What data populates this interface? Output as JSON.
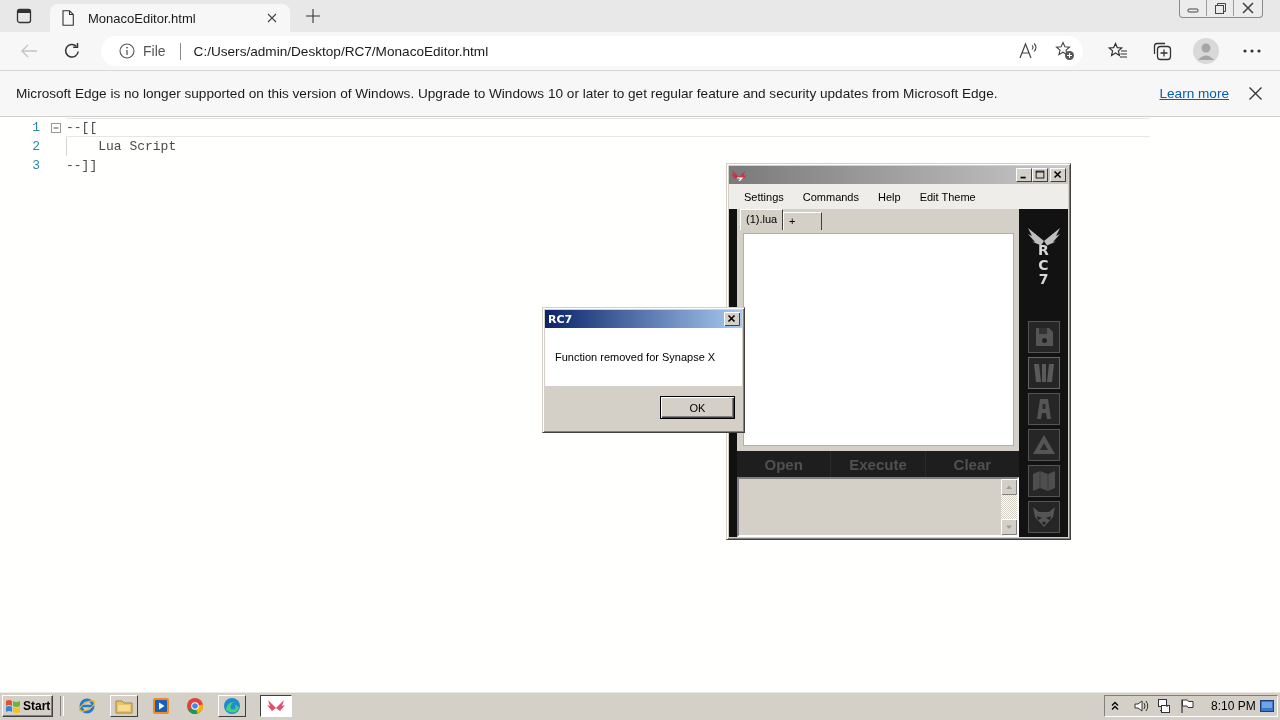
{
  "browser": {
    "tabs": [
      {
        "title": "MonacoEditor.html",
        "selected": true
      }
    ],
    "nav": {
      "back_disabled": true
    },
    "address_bar": {
      "scheme": "File",
      "url": "C:/Users/admin/Desktop/RC7/MonacoEditor.html"
    },
    "info_bar": {
      "message": "Microsoft Edge is no longer supported on this version of Windows. Upgrade to Windows 10 or later to get regular feature and security updates from Microsoft Edge.",
      "link": "Learn more"
    }
  },
  "editor": {
    "lines": [
      {
        "number": "1",
        "text": "--[[",
        "fold": true,
        "guide": false,
        "current": true
      },
      {
        "number": "2",
        "text": "    Lua Script",
        "fold": false,
        "guide": true,
        "current": false
      },
      {
        "number": "3",
        "text": "--]]",
        "fold": false,
        "guide": false,
        "current": false
      }
    ]
  },
  "rc7_window": {
    "menu": [
      "Settings",
      "Commands",
      "Help",
      "Edit Theme"
    ],
    "tabs": [
      {
        "label": "(1).lua",
        "selected": true
      },
      {
        "label": "+",
        "selected": false
      }
    ],
    "logo_text": "RC7",
    "actions": [
      "Open",
      "Execute",
      "Clear"
    ]
  },
  "dialog": {
    "title": "RC7",
    "message": "Function removed for Synapse X",
    "buttons": [
      "OK"
    ]
  },
  "taskbar": {
    "start": "Start",
    "clock": "8:10 PM"
  }
}
